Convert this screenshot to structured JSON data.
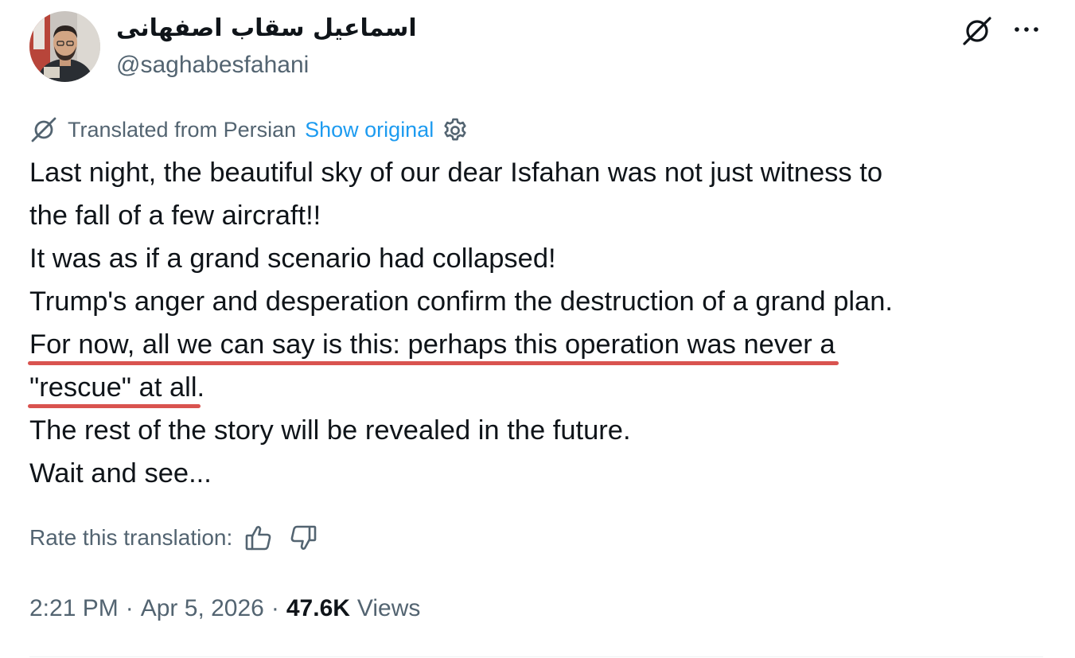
{
  "author": {
    "display_name": "اسماعیل سقاب اصفهانی",
    "handle": "@saghabesfahani",
    "avatar_icon": "profile-photo"
  },
  "header": {
    "translate_icon": "translate-slash-icon",
    "more_icon": "more-dots-icon"
  },
  "translation": {
    "label": "Translated from Persian",
    "show_original": "Show original",
    "accent_color": "#1d9bf0"
  },
  "tweet": {
    "lines": [
      "Last night, the beautiful sky of our dear Isfahan was not just witness to",
      "the fall of a few aircraft!!",
      "It was as if a grand scenario had collapsed!",
      "Trump's anger and desperation confirm the destruction of a grand plan."
    ],
    "highlighted": [
      "For now, all we can say is this: perhaps this operation was never a",
      "\"rescue\" at all"
    ],
    "after_highlight": ".",
    "lines_after": [
      "The rest of the story will be revealed in the future.",
      "Wait and see..."
    ],
    "highlight_color": "#d9534f"
  },
  "rate": {
    "label": "Rate this translation:"
  },
  "meta": {
    "time": "2:21 PM",
    "separator": "·",
    "date": "Apr 5, 2026",
    "views_count": "47.6K",
    "views_label": "Views"
  }
}
